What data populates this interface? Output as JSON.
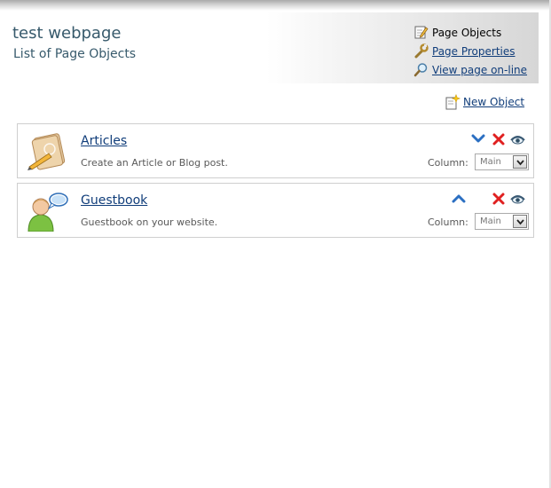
{
  "header": {
    "title": "test webpage",
    "subtitle": "List of Page Objects",
    "menu": {
      "current": "Page Objects",
      "properties": "Page Properties",
      "view_online": "View page on-line"
    }
  },
  "toolbar": {
    "new_object": "New Object"
  },
  "objects": [
    {
      "title": "Articles",
      "description": "Create an Article or Blog post.",
      "column_label": "Column:",
      "column_value": "Main",
      "icon": "notebook-pencil-icon",
      "move": "move-down"
    },
    {
      "title": "Guestbook",
      "description": "Guestbook on your website.",
      "column_label": "Column:",
      "column_value": "Main",
      "icon": "user-speech-bubble-icon",
      "move": "move-up"
    }
  ],
  "colors": {
    "title_text": "#375a6c",
    "link": "#103d7a",
    "panel_border": "#cfcfcf",
    "delete_red": "#e02020",
    "arrow_blue": "#2b6fc2"
  }
}
